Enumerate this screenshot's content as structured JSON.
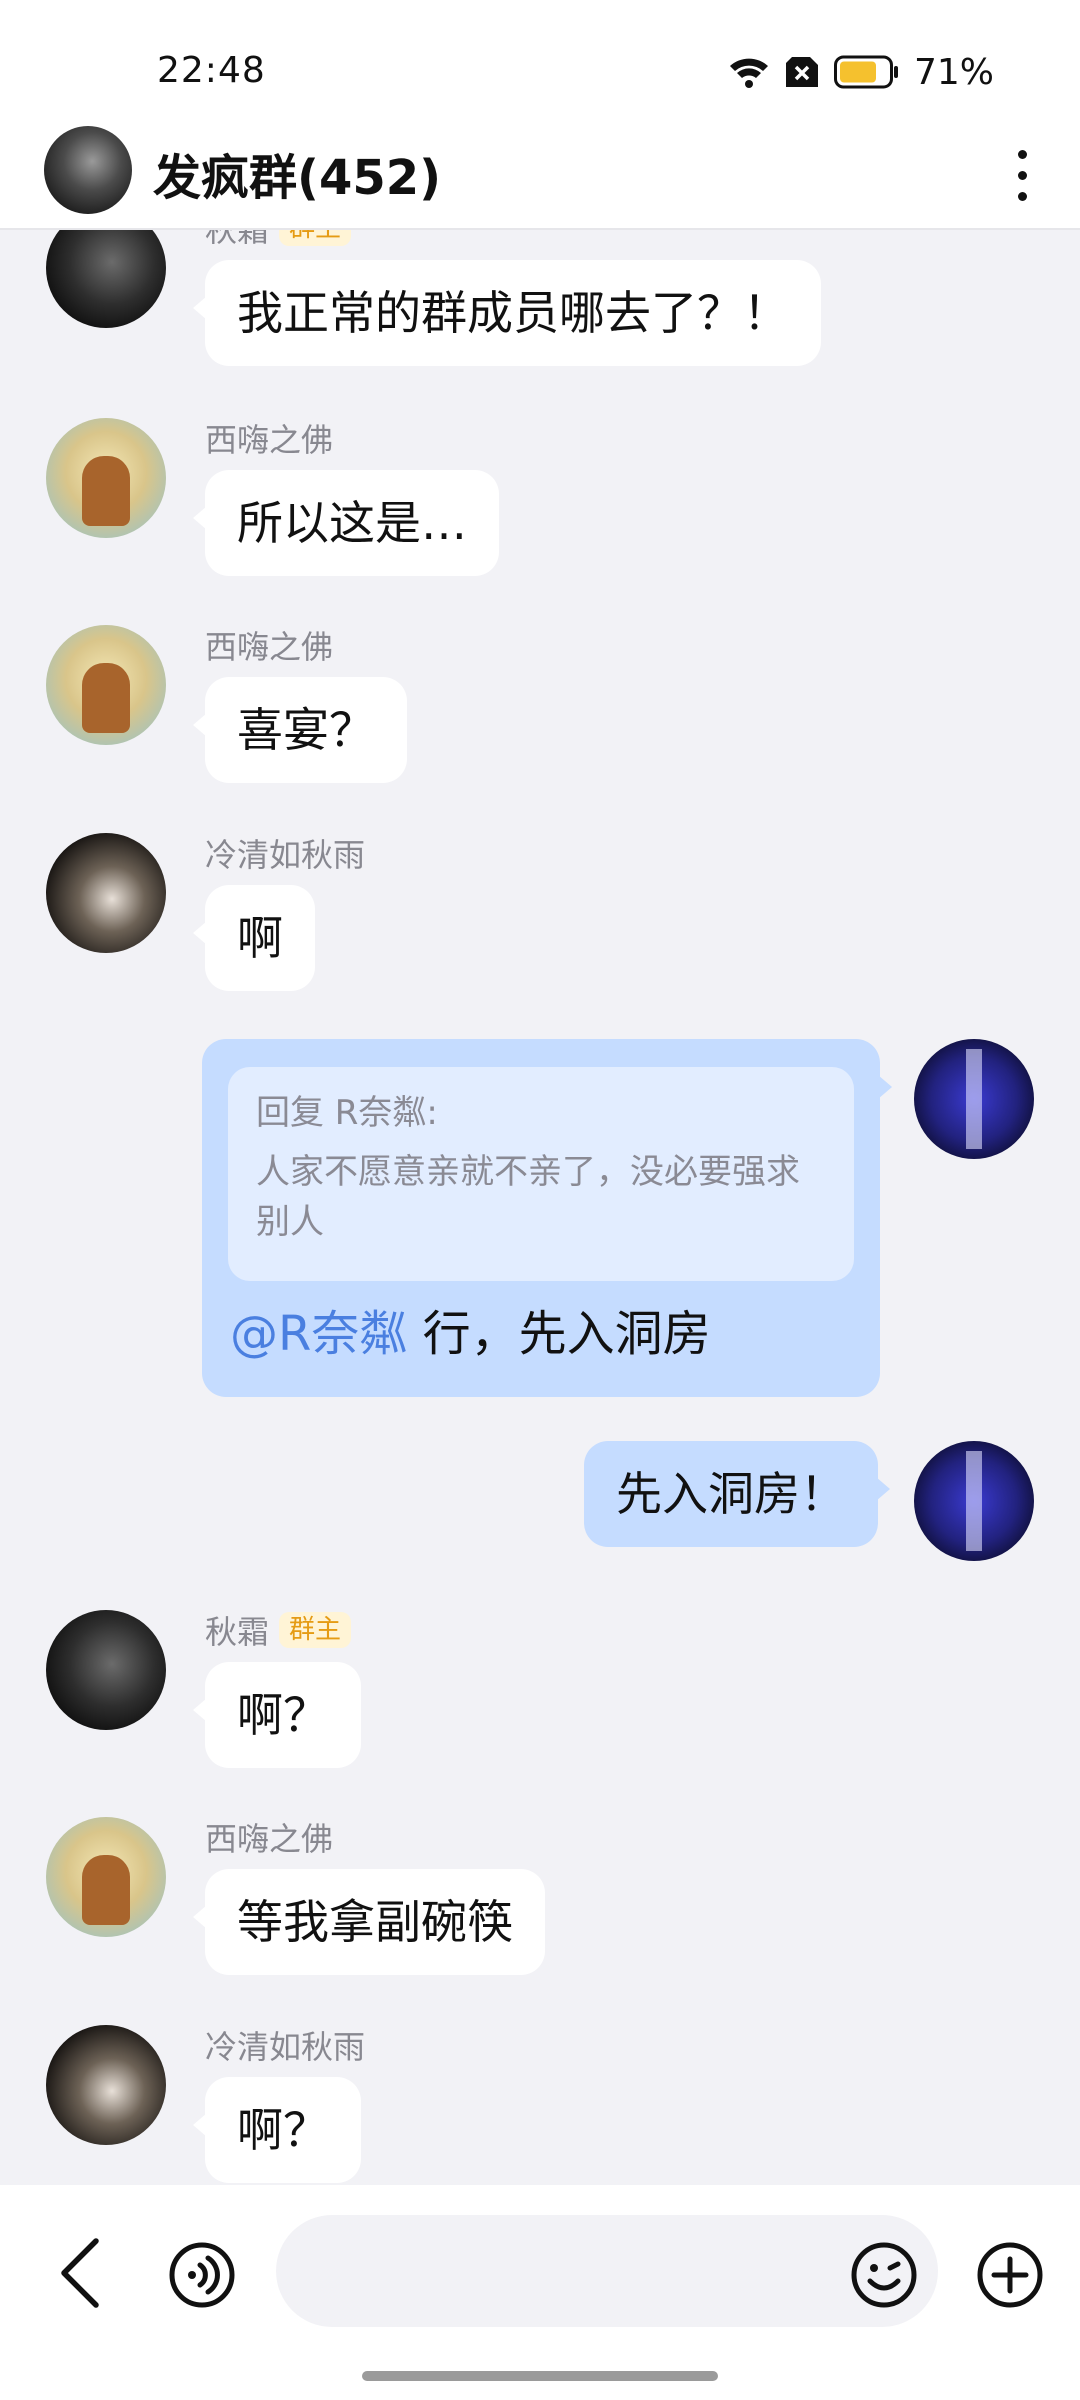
{
  "status_bar": {
    "time": "22:48",
    "battery": "71%",
    "icons": [
      "wifi-icon",
      "sim-off-icon",
      "battery-icon"
    ],
    "battery_color": "#f5c12e"
  },
  "header": {
    "title": "发疯群(452)",
    "avatar_icon": "group-avatar",
    "menu_icon": "more-vertical-icon"
  },
  "messages": [
    {
      "sender": "秋霜",
      "badge": "群主",
      "text": "我正常的群成员哪去了？！",
      "direction": "in"
    },
    {
      "sender": "西嗨之佛",
      "text": "所以这是…",
      "direction": "in"
    },
    {
      "sender": "西嗨之佛",
      "text": "喜宴？",
      "direction": "in"
    },
    {
      "sender": "冷清如秋雨",
      "text": "啊",
      "direction": "in"
    },
    {
      "direction": "out",
      "reply": {
        "title": "回复 R奈粼:",
        "quote": "人家不愿意亲就不亲了，没必要强求别人",
        "mention": "@R奈粼",
        "text": " 行，先入洞房"
      }
    },
    {
      "text": "先入洞房！",
      "direction": "out"
    },
    {
      "sender": "秋霜",
      "badge": "群主",
      "text": "啊？",
      "direction": "in"
    },
    {
      "sender": "西嗨之佛",
      "text": "等我拿副碗筷",
      "direction": "in"
    },
    {
      "sender": "冷清如秋雨",
      "text": "啊？",
      "direction": "in"
    }
  ],
  "input_bar": {
    "placeholder": "",
    "icons": [
      "back-icon",
      "voice-icon",
      "emoji-icon",
      "plus-icon"
    ]
  },
  "colors": {
    "outgoing_bubble": "#c5dcff",
    "mention": "#4a7fe0",
    "badge_text": "#e59b14",
    "badge_bg": "#fff4d6"
  }
}
